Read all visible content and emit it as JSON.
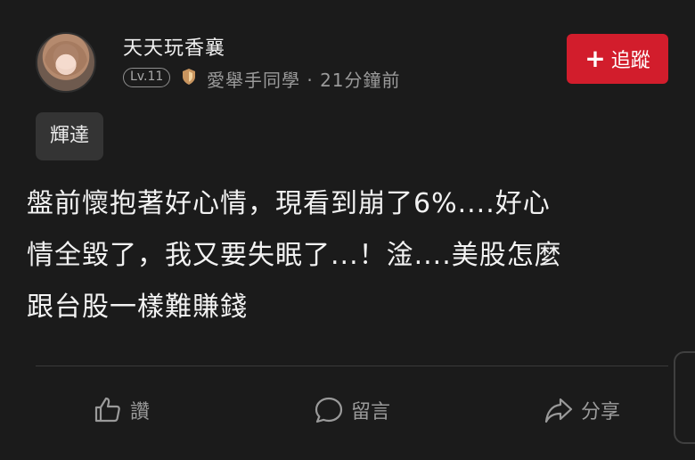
{
  "author": {
    "name": "天天玩香襄",
    "level": "Lv.11",
    "board": "愛舉手同學",
    "separator": "·",
    "time": "21分鐘前"
  },
  "follow_button": {
    "label": "追蹤"
  },
  "tag": {
    "label": "輝達"
  },
  "post": {
    "text": "盤前懷抱著好心情，現看到崩了6%....好心\n情全毀了，我又要失眠了...！淦....美股怎麼\n跟台股一樣難賺錢"
  },
  "actions": {
    "like_label": "讚",
    "comment_label": "留言",
    "share_label": "分享"
  },
  "colors": {
    "background": "#1b1b1b",
    "follow_button": "#d21d2c",
    "tag_chip": "#343434"
  },
  "icons": {
    "avatar": "profile-photo",
    "level_shield": "shield-icon",
    "like": "thumbs-up-icon",
    "comment": "speech-bubble-icon",
    "share": "share-arrow-icon"
  }
}
